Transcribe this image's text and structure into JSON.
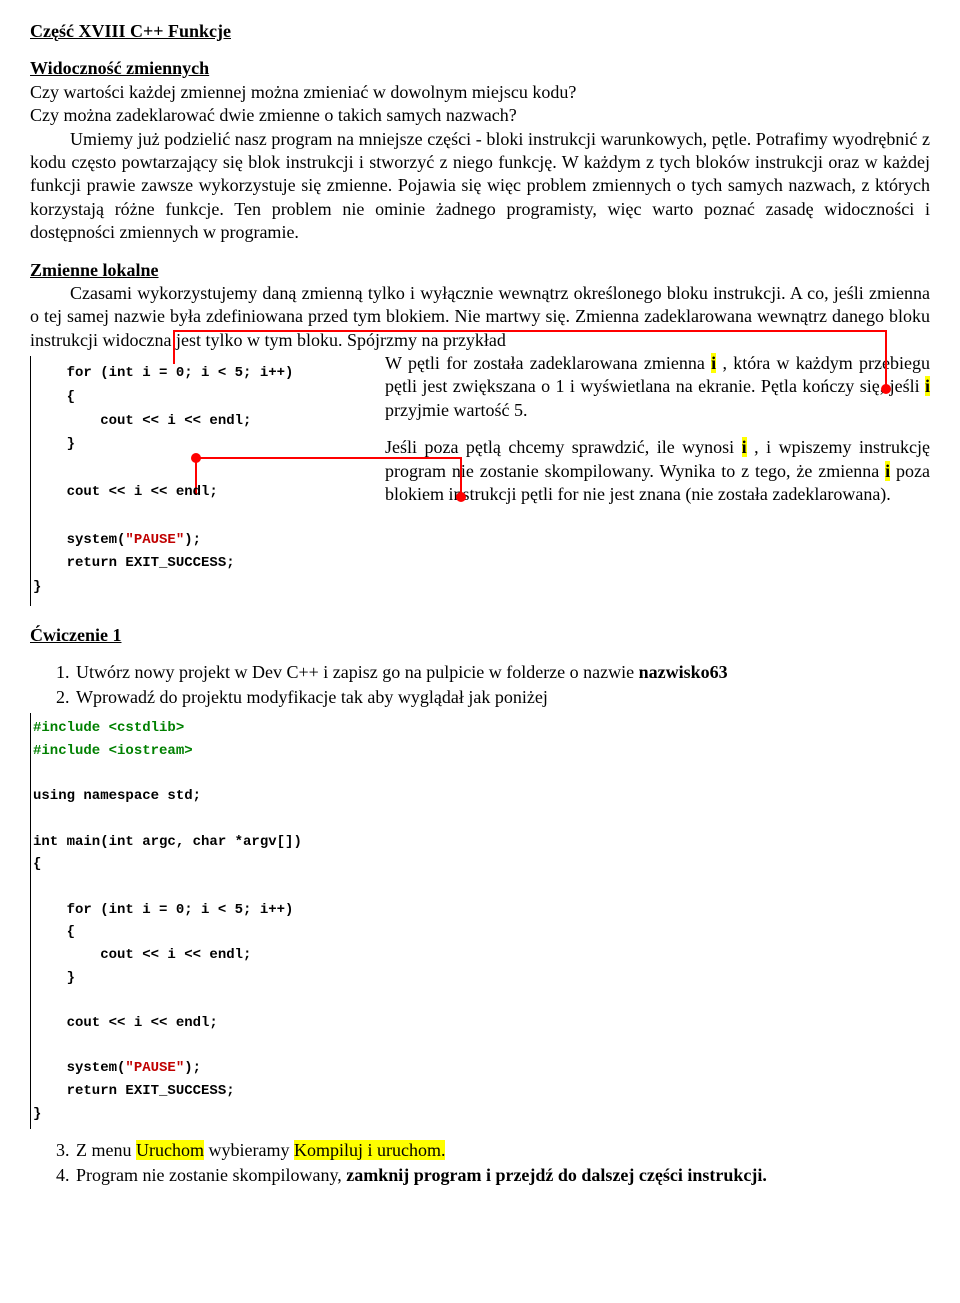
{
  "title": "Część XVIII C++ Funkcje",
  "intro": {
    "heading": "Widoczność zmiennych",
    "q1": "Czy wartości każdej zmiennej można zmieniać w dowolnym miejscu kodu?",
    "q2": "Czy można zadeklarować dwie zmienne o takich samych nazwach?",
    "body": "Umiemy już podzielić nasz program na mniejsze części - bloki instrukcji warunkowych, pętle. Potrafimy wyodrębnić z kodu często powtarzający się blok instrukcji i stworzyć z niego funkcję. W każdym z tych bloków instrukcji oraz w każdej funkcji prawie zawsze wykorzystuje się zmienne. Pojawia się więc problem zmiennych o tych samych nazwach, z których korzystają różne funkcje. Ten problem nie ominie żadnego programisty, więc warto poznać zasadę widoczności i dostępności zmiennych w programie."
  },
  "local": {
    "heading": "Zmienne lokalne",
    "body_a": "Czasami wykorzystujemy daną zmienną tylko i wyłącznie wewnątrz określonego bloku instrukcji. A co, jeśli zmienna o tej samej nazwie była zdefiniowana przed tym blokiem. Nie martwy się. Zmienna zadeklarowana wewnątrz danego bloku instrukcji widoczna jest tylko w tym bloku. Spójrzmy na przykład"
  },
  "code1": {
    "l1": "    for (int i = 0; i < 5; i++)",
    "l2": "    {",
    "l3": "        cout << i << endl;",
    "l4": "    }",
    "l5": "",
    "l6": "    cout << i << endl;",
    "l7": "",
    "l8a": "    system(",
    "l8b": "\"PAUSE\"",
    "l8c": ");",
    "l9": "    return EXIT_SUCCESS;",
    "l10": "}"
  },
  "right": {
    "p1a": "W pętli for została zadeklarowana zmienna ",
    "p1b": " , która w każdym przebiegu pętli jest zwiększana o 1 i wyświetlana na ekranie. Pętla kończy się, jeśli ",
    "p1c": " przyjmie wartość 5.",
    "p2a": "Jeśli poza pętlą chcemy sprawdzić, ile wynosi ",
    "p2b": " , i wpiszemy instrukcję program nie zostanie skompilowany. Wynika to z tego, że zmienna ",
    "p2c": " poza blokiem instrukcji pętli for nie jest znana (nie została zadeklarowana).",
    "i": "i"
  },
  "exercise": {
    "title": "Ćwiczenie 1",
    "items12": {
      "n1a": "Utwórz nowy projekt w Dev C++ i zapisz go na pulpicie w folderze o nazwie ",
      "n1b": "nazwisko63",
      "n2": "Wprowadź do projektu modyfikacje tak aby wyglądał jak poniżej"
    },
    "items34": {
      "n3a": "Z menu ",
      "n3b": "Uruchom",
      "n3c": " wybieramy ",
      "n3d": "Kompiluj i uruchom.",
      "n4a": "Program nie zostanie skompilowany, ",
      "n4b": "zamknij program i przejdź do dalszej części instrukcji."
    }
  },
  "code2": {
    "l1": "#include <cstdlib>",
    "l2": "#include <iostream>",
    "l3": "",
    "l4": "using namespace std;",
    "l5": "",
    "l6": "int main(int argc, char *argv[])",
    "l7": "{",
    "l8": "",
    "l9": "    for (int i = 0; i < 5; i++)",
    "l10": "    {",
    "l11": "        cout << i << endl;",
    "l12": "    }",
    "l13": "",
    "l14": "    cout << i << endl;",
    "l15": "",
    "l16a": "    system(",
    "l16b": "\"PAUSE\"",
    "l16c": ");",
    "l17": "    return EXIT_SUCCESS;",
    "l18": "}"
  }
}
